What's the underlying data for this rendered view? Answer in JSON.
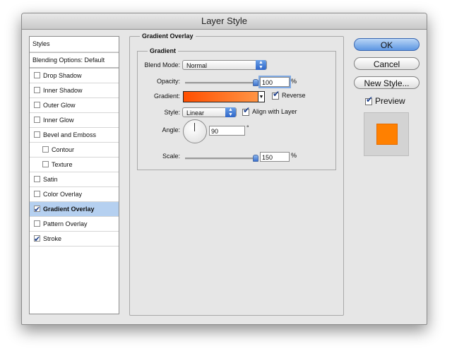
{
  "window": {
    "title": "Layer Style"
  },
  "styles_list": {
    "header": "Styles",
    "blending": "Blending Options: Default",
    "items": [
      {
        "label": "Drop Shadow",
        "checked": false,
        "indent": false,
        "selected": false
      },
      {
        "label": "Inner Shadow",
        "checked": false,
        "indent": false,
        "selected": false
      },
      {
        "label": "Outer Glow",
        "checked": false,
        "indent": false,
        "selected": false
      },
      {
        "label": "Inner Glow",
        "checked": false,
        "indent": false,
        "selected": false
      },
      {
        "label": "Bevel and Emboss",
        "checked": false,
        "indent": false,
        "selected": false
      },
      {
        "label": "Contour",
        "checked": false,
        "indent": true,
        "selected": false
      },
      {
        "label": "Texture",
        "checked": false,
        "indent": true,
        "selected": false
      },
      {
        "label": "Satin",
        "checked": false,
        "indent": false,
        "selected": false
      },
      {
        "label": "Color Overlay",
        "checked": false,
        "indent": false,
        "selected": false
      },
      {
        "label": "Gradient Overlay",
        "checked": true,
        "indent": false,
        "selected": true
      },
      {
        "label": "Pattern Overlay",
        "checked": false,
        "indent": false,
        "selected": false
      },
      {
        "label": "Stroke",
        "checked": true,
        "indent": false,
        "selected": false
      }
    ]
  },
  "panel": {
    "title": "Gradient Overlay",
    "group": "Gradient",
    "blend_mode_label": "Blend Mode:",
    "blend_mode_value": "Normal",
    "opacity_label": "Opacity:",
    "opacity_value": "100",
    "opacity_level": 1.0,
    "percent": "%",
    "gradient_label": "Gradient:",
    "gradient_colors": [
      "#ff4f00",
      "#ff9a4a"
    ],
    "reverse_label": "Reverse",
    "style_label": "Style:",
    "style_value": "Linear",
    "align_label": "Align with Layer",
    "angle_label": "Angle:",
    "angle_value": "90",
    "degree": "°",
    "scale_label": "Scale:",
    "scale_value": "150",
    "scale_level": 1.0
  },
  "buttons": {
    "ok": "OK",
    "cancel": "Cancel",
    "new_style": "New Style..."
  },
  "preview": {
    "label": "Preview",
    "color": "#ff8000"
  }
}
